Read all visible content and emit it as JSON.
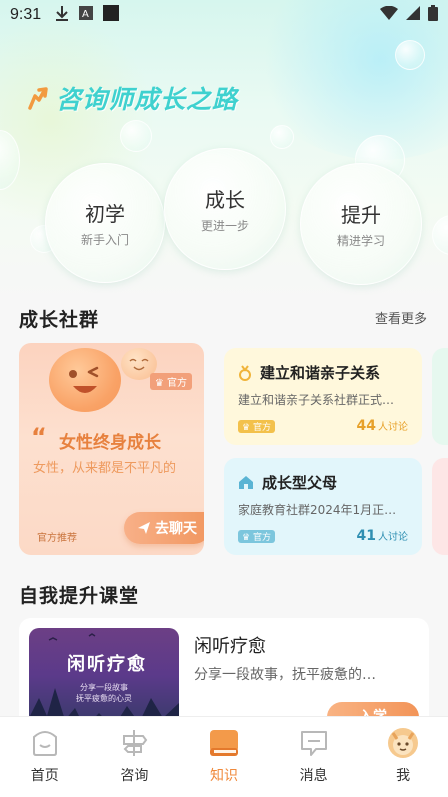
{
  "status_bar": {
    "time": "9:31"
  },
  "hero": {
    "title": "咨询师成长之路"
  },
  "stages": [
    {
      "title": "初学",
      "subtitle": "新手入门"
    },
    {
      "title": "成长",
      "subtitle": "更进一步"
    },
    {
      "title": "提升",
      "subtitle": "精进学习"
    }
  ],
  "community": {
    "title": "成长社群",
    "more": "查看更多",
    "featured": {
      "badge": "官方",
      "title": "女性终身成长",
      "subtitle": "女性，从来都是不平凡的",
      "recommend": "官方推荐",
      "button": "去聊天"
    },
    "groups": [
      {
        "name": "建立和谐亲子关系",
        "desc": "建立和谐亲子关系社群正式…",
        "tag": "官方",
        "count": "44",
        "count_label": "人讨论",
        "accent": "#f0b43a"
      },
      {
        "name": "成长型父母",
        "desc": "家庭教育社群2024年1月正…",
        "tag": "官方",
        "count": "41",
        "count_label": "人讨论",
        "accent": "#3fa7c8"
      }
    ]
  },
  "classroom": {
    "title": "自我提升课堂",
    "course": {
      "thumb_title": "闲听疗愈",
      "thumb_line1": "分享一段故事",
      "thumb_line2": "抚平疲惫的心灵",
      "title": "闲听疗愈",
      "desc": "分享一段故事，抚平疲惫的…",
      "button": "入学"
    }
  },
  "tabs": [
    {
      "label": "首页",
      "icon": "home-icon"
    },
    {
      "label": "咨询",
      "icon": "consult-icon"
    },
    {
      "label": "知识",
      "icon": "book-icon",
      "active": true
    },
    {
      "label": "消息",
      "icon": "message-icon"
    },
    {
      "label": "我",
      "icon": "avatar-icon"
    }
  ],
  "colors": {
    "accent": "#f08a3c",
    "hero_title": "#3fd1cf"
  }
}
